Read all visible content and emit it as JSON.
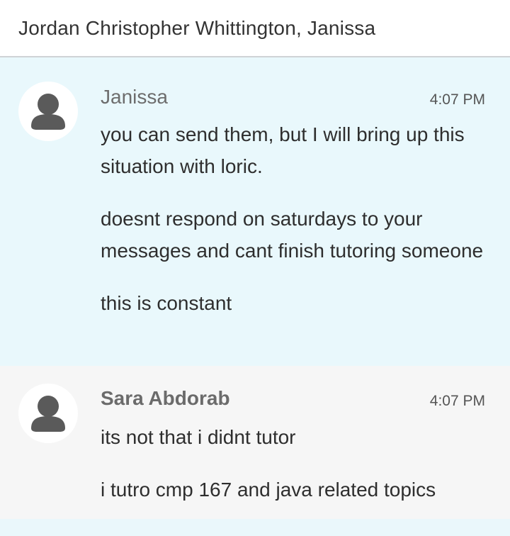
{
  "header": {
    "title": "Jordan Christopher Whittington, Janissa"
  },
  "messages": [
    {
      "sender": "Janissa",
      "time": "4:07 PM",
      "paragraphs": [
        "you can send them, but I will bring up this situation with loric.",
        "doesnt respond on saturdays to your messages and cant finish tutoring someone",
        "this is constant"
      ]
    },
    {
      "sender": "Sara Abdorab",
      "time": "4:07 PM",
      "paragraphs": [
        "its not that i didnt tutor",
        "i tutro cmp 167 and java related topics"
      ]
    }
  ],
  "icons": {
    "avatar": "person-icon"
  },
  "colors": {
    "header_bg": "#ffffff",
    "highlight_bg": "#e9f8fc",
    "plain_bg": "#f6f6f6",
    "avatar_bg": "#ffffff",
    "avatar_icon": "#5a5a5a"
  }
}
